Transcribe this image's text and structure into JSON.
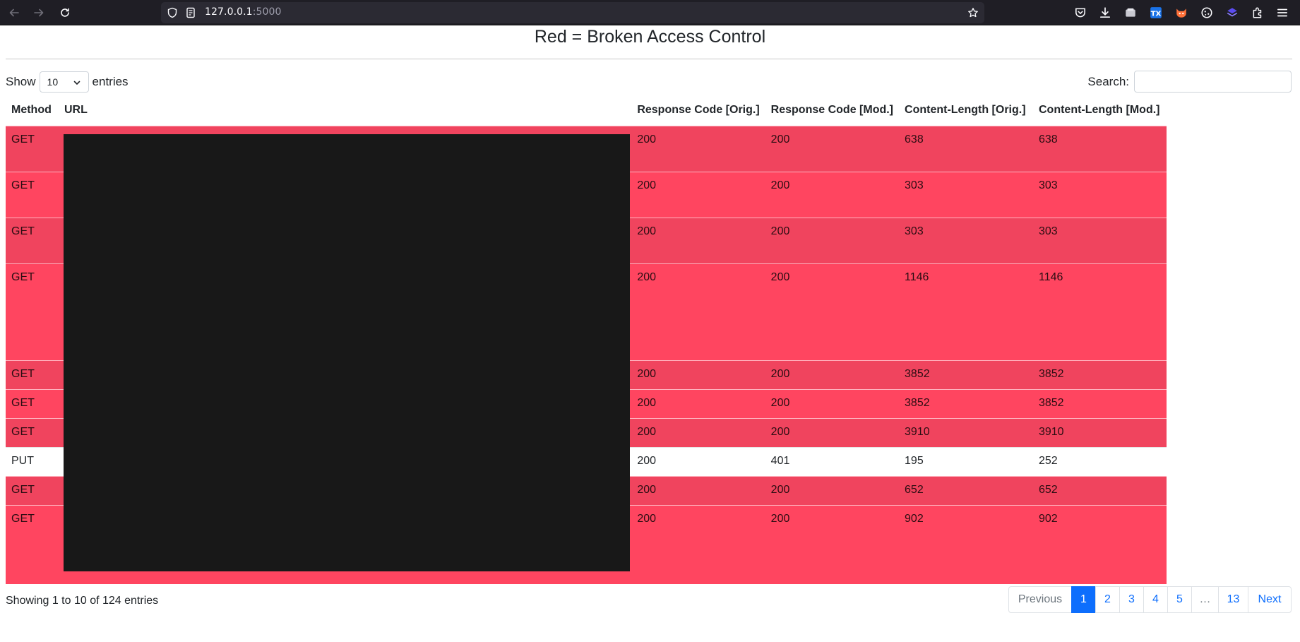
{
  "browser": {
    "url_host": "127.0.0.1",
    "url_port": ":5000",
    "icons": [
      "back-arrow-icon",
      "forward-arrow-icon",
      "reload-icon",
      "shield-icon",
      "page-info-icon",
      "bookmark-star-icon",
      "pocket-icon",
      "download-icon",
      "screenshot-icon",
      "extension-tx-icon",
      "extension-fox-icon",
      "extension-cookie-icon",
      "extension-blue-icon",
      "extensions-puzzle-icon",
      "app-menu-icon"
    ]
  },
  "page": {
    "title": "Red = Broken Access Control"
  },
  "controls": {
    "show_label": "Show",
    "length_value": "10",
    "entries_label": "entries",
    "search_label": "Search:",
    "search_value": ""
  },
  "table": {
    "headers": {
      "method": "Method",
      "url": "URL",
      "rc_orig": "Response Code [Orig.]",
      "rc_mod": "Response Code [Mod.]",
      "cl_orig": "Content-Length [Orig.]",
      "cl_mod": "Content-Length [Mod.]"
    },
    "rows": [
      {
        "method": "GET",
        "url": "",
        "rc_orig": "200",
        "rc_mod": "200",
        "cl_orig": "638",
        "cl_mod": "638",
        "highlight": "red"
      },
      {
        "method": "GET",
        "url": "",
        "rc_orig": "200",
        "rc_mod": "200",
        "cl_orig": "303",
        "cl_mod": "303",
        "highlight": "red"
      },
      {
        "method": "GET",
        "url": "",
        "rc_orig": "200",
        "rc_mod": "200",
        "cl_orig": "303",
        "cl_mod": "303",
        "highlight": "red"
      },
      {
        "method": "GET",
        "url": "",
        "rc_orig": "200",
        "rc_mod": "200",
        "cl_orig": "1146",
        "cl_mod": "1146",
        "highlight": "red"
      },
      {
        "method": "GET",
        "url": "",
        "rc_orig": "200",
        "rc_mod": "200",
        "cl_orig": "3852",
        "cl_mod": "3852",
        "highlight": "red"
      },
      {
        "method": "GET",
        "url": "",
        "rc_orig": "200",
        "rc_mod": "200",
        "cl_orig": "3852",
        "cl_mod": "3852",
        "highlight": "red"
      },
      {
        "method": "GET",
        "url": "",
        "rc_orig": "200",
        "rc_mod": "200",
        "cl_orig": "3910",
        "cl_mod": "3910",
        "highlight": "red"
      },
      {
        "method": "PUT",
        "url": "",
        "rc_orig": "200",
        "rc_mod": "401",
        "cl_orig": "195",
        "cl_mod": "252",
        "highlight": "none"
      },
      {
        "method": "GET",
        "url": "",
        "rc_orig": "200",
        "rc_mod": "200",
        "cl_orig": "652",
        "cl_mod": "652",
        "highlight": "red"
      },
      {
        "method": "GET",
        "url": "",
        "rc_orig": "200",
        "rc_mod": "200",
        "cl_orig": "902",
        "cl_mod": "902",
        "highlight": "red"
      }
    ],
    "highlight_color": "#ff4560"
  },
  "footer": {
    "info": "Showing 1 to 10 of 124 entries",
    "pagination": [
      "Previous",
      "1",
      "2",
      "3",
      "4",
      "5",
      "…",
      "13",
      "Next"
    ],
    "active_page": "1",
    "accent": "#0d6efd"
  }
}
